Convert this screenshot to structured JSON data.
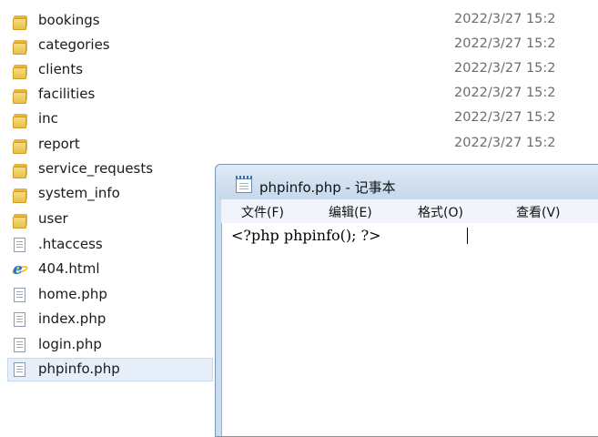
{
  "explorer": {
    "items": [
      {
        "name": "bookings",
        "date": "2022/3/27 15:2",
        "type": "folder"
      },
      {
        "name": "categories",
        "date": "2022/3/27 15:2",
        "type": "folder"
      },
      {
        "name": "clients",
        "date": "2022/3/27 15:2",
        "type": "folder"
      },
      {
        "name": "facilities",
        "date": "2022/3/27 15:2",
        "type": "folder"
      },
      {
        "name": "inc",
        "date": "2022/3/27 15:2",
        "type": "folder"
      },
      {
        "name": "report",
        "date": "2022/3/27 15:2",
        "type": "folder"
      },
      {
        "name": "service_requests",
        "date": "",
        "type": "folder"
      },
      {
        "name": "system_info",
        "date": "",
        "type": "folder"
      },
      {
        "name": "user",
        "date": "",
        "type": "folder"
      },
      {
        "name": ".htaccess",
        "date": "",
        "type": "file"
      },
      {
        "name": "404.html",
        "date": "",
        "type": "ie"
      },
      {
        "name": "home.php",
        "date": "",
        "type": "file"
      },
      {
        "name": "index.php",
        "date": "",
        "type": "file"
      },
      {
        "name": "login.php",
        "date": "",
        "type": "file"
      },
      {
        "name": "phpinfo.php",
        "date": "",
        "type": "file"
      }
    ]
  },
  "notepad": {
    "title": "phpinfo.php - 记事本",
    "menu": [
      "文件(F)",
      "编辑(E)",
      "格式(O)",
      "查看(V)"
    ],
    "content": "<?php phpinfo(); ?>"
  },
  "colors": {
    "folder": "#e8b53a",
    "selection": "#e5eef9",
    "titlebar": "#c9dcf0",
    "ie_blue": "#1f72d6"
  }
}
